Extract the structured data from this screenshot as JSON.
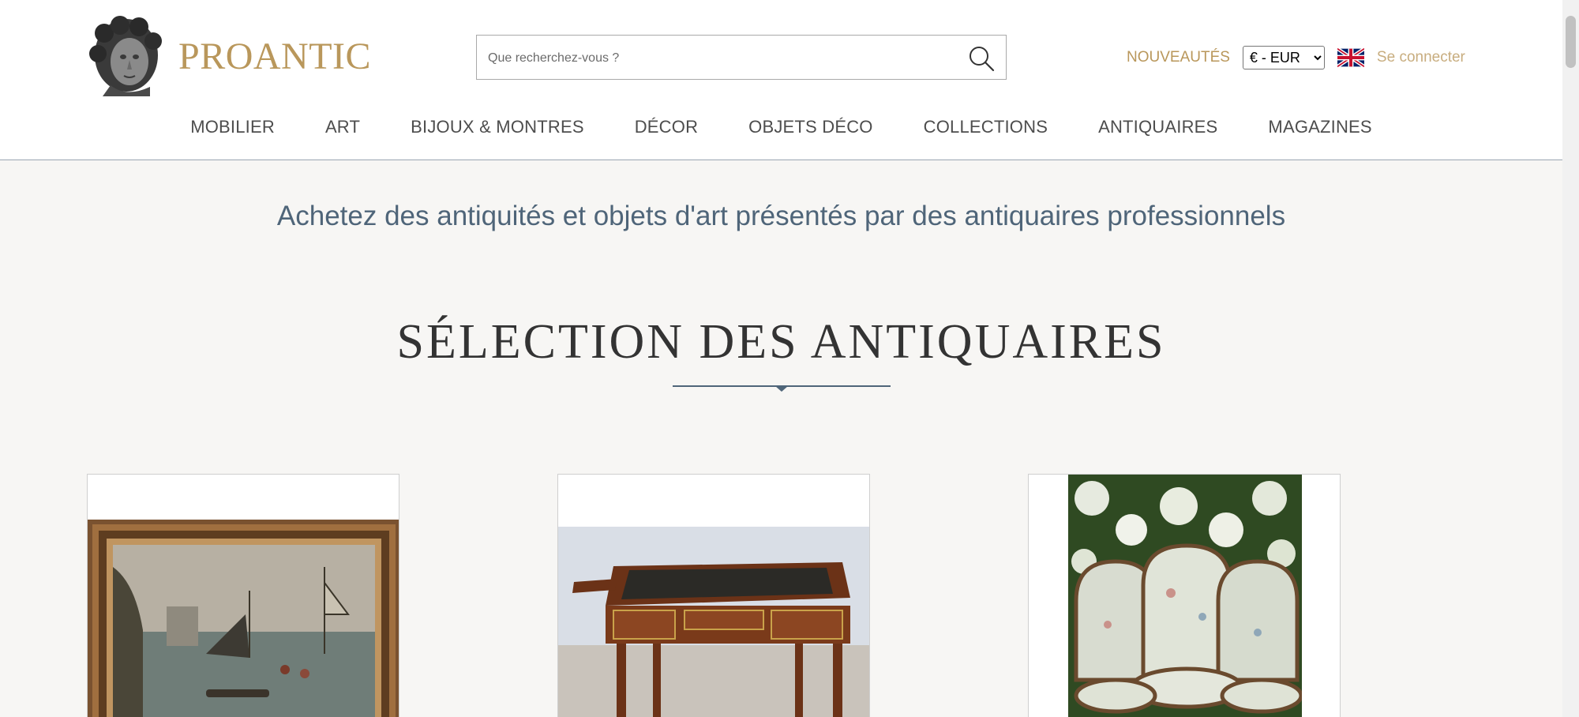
{
  "header": {
    "logo_text": "PROANTIC",
    "search_placeholder": "Que recherchez-vous ?",
    "new_link": "NOUVEAUTÉS",
    "currency_selected": "€ - EUR",
    "login_link": "Se connecter",
    "language_icon": "uk-flag-icon"
  },
  "nav": {
    "items": [
      "MOBILIER",
      "ART",
      "BIJOUX & MONTRES",
      "DÉCOR",
      "OBJETS DÉCO",
      "COLLECTIONS",
      "ANTIQUAIRES",
      "MAGAZINES"
    ]
  },
  "main": {
    "tagline": "Achetez des antiquités et objets d'art présentés par des antiquaires professionnels",
    "section_title": "SÉLECTION DES ANTIQUAIRES"
  },
  "colors": {
    "accent_gold": "#b9975b",
    "navy": "#4f6579",
    "background": "#f7f6f4"
  }
}
